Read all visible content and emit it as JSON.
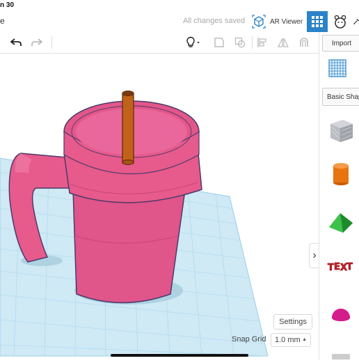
{
  "status_bar": {
    "time": "n 30"
  },
  "topbar": {
    "home_label": "e",
    "changes_status": "All changes saved",
    "ar_viewer_label": "AR Viewer",
    "accent_color": "#2b83c9"
  },
  "toolbar": {
    "icons": [
      "undo-icon",
      "redo-icon",
      "lightbulb-icon",
      "note-icon",
      "group-icon",
      "ungroup-icon",
      "align-icon",
      "mirror-icon",
      "magnet-icon"
    ]
  },
  "right_panel": {
    "import_label": "Import",
    "category_label": "Basic Shap",
    "shapes": [
      "box-hole",
      "cylinder",
      "roof",
      "text",
      "half-sphere"
    ]
  },
  "canvas": {
    "model_colors": {
      "mug": "#e75a8c",
      "straw": "#c0621a",
      "grid": "#cfe9f5"
    },
    "settings_label": "Settings",
    "snap_grid_label": "Snap Grid",
    "snap_grid_value": "1.0 mm"
  }
}
